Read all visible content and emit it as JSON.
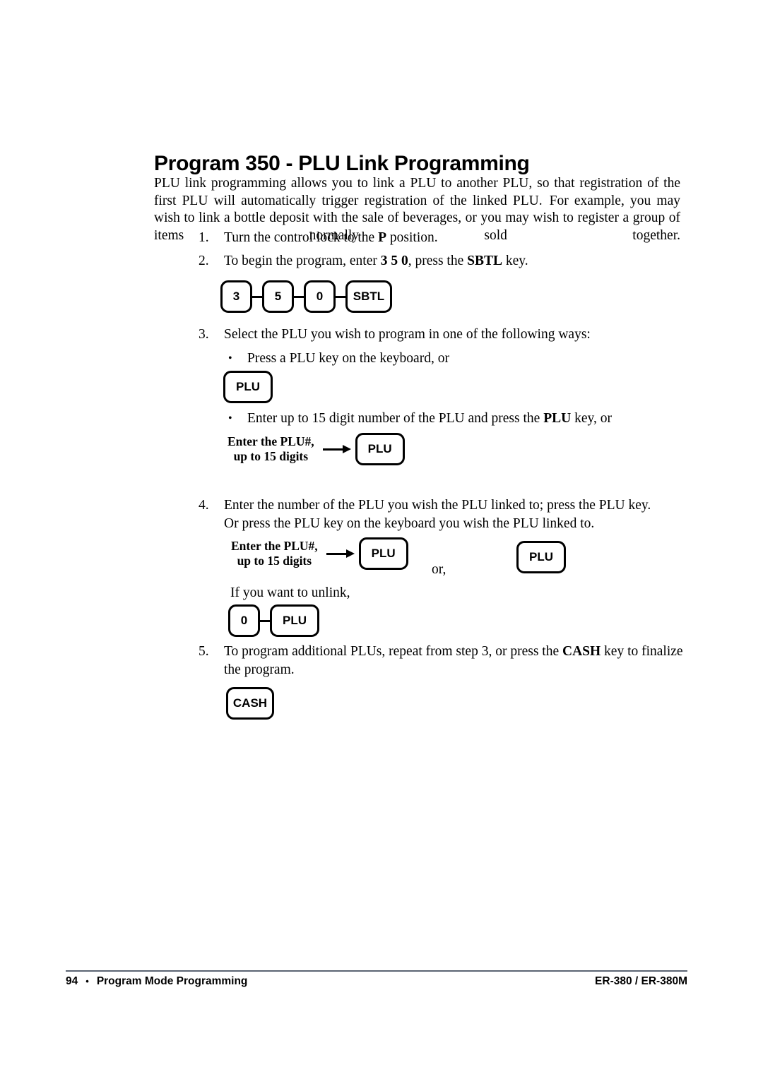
{
  "document": {
    "title": "Program 350 - PLU Link Programming",
    "intro": {
      "part1": "PLU link programming allows you to link a PLU to another PLU, so that registration of the first PLU will automatically trigger registration of the linked PLU.",
      "part2": "For example, you may wish to link a bottle deposit with the sale of beverages, or you may wish to register a group of items normally sold together."
    },
    "steps": [
      {
        "number": "1.",
        "text_before": "Turn the control lock to the ",
        "bold": "P",
        "text_after": " position."
      },
      {
        "number": "2.",
        "text_before": "To begin the program, enter ",
        "bold": "3 5 0",
        "text_mid": ", press the ",
        "bold2": "SBTL",
        "text_after": " key."
      },
      {
        "number": "3.",
        "text": "Select the PLU you wish to program in one of the following ways:"
      },
      {
        "number": "4.",
        "line1": "Enter the number of the PLU you wish the PLU linked to; press the PLU key.",
        "line2": "Or press the PLU key on the keyboard you wish the PLU linked to."
      },
      {
        "number": "5.",
        "text_before": "To program additional PLUs, repeat from step 3, or press the ",
        "bold": "CASH",
        "text_after": " key to finalize the program."
      }
    ],
    "bullets": [
      {
        "marker": "•",
        "text": "Press a PLU key on the keyboard, or"
      },
      {
        "marker": "•",
        "text_before": "Enter up to 15 digit number of the PLU and press the ",
        "bold": "PLU",
        "text_after": " key, or"
      }
    ],
    "unlink_line": "If you want to unlink,",
    "or_connector": "or,",
    "diagram_label": {
      "line1": "Enter the PLU#,",
      "line2": "up to 15 digits"
    },
    "key_sequences": {
      "program_350": [
        "3",
        "5",
        "0",
        "SBTL"
      ],
      "plu_single": [
        "PLU"
      ],
      "zero_plu": [
        "0",
        "PLU"
      ],
      "cash": [
        "CASH"
      ],
      "plu_after_arrow": "PLU",
      "plu_alternate": "PLU"
    }
  },
  "footer": {
    "page_number": "94",
    "separator": "•",
    "section": "Program Mode Programming",
    "model": "ER-380 / ER-380M"
  }
}
